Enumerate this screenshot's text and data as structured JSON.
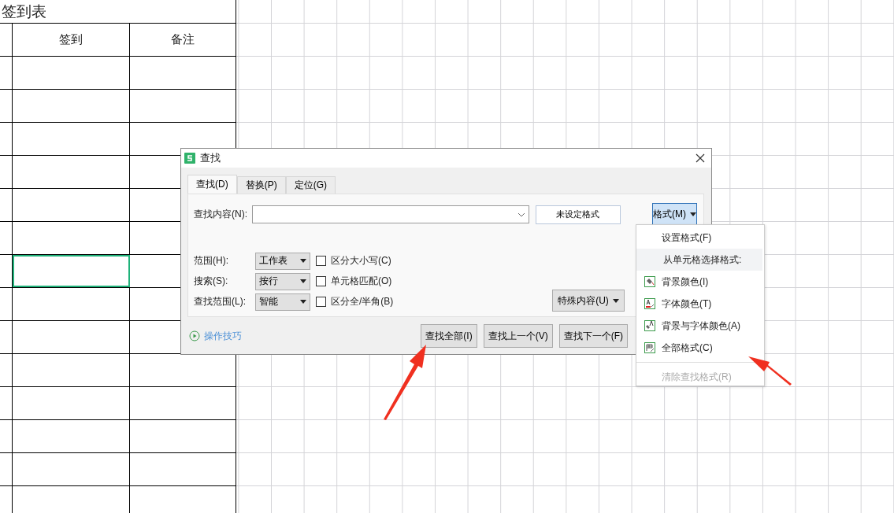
{
  "sheet": {
    "title": "签到表",
    "columns": [
      "签到",
      "备注"
    ],
    "rows": [
      {
        "selected": false
      },
      {
        "selected": false
      },
      {
        "selected": false
      },
      {
        "selected": false
      },
      {
        "selected": false
      },
      {
        "selected": false
      },
      {
        "selected": true
      },
      {
        "selected": false
      },
      {
        "selected": false
      },
      {
        "selected": false
      },
      {
        "selected": false
      },
      {
        "selected": false
      },
      {
        "selected": false
      },
      {
        "selected": false
      }
    ]
  },
  "dialog": {
    "title": "查找",
    "tabs": [
      {
        "label": "查找(D)",
        "selected": true
      },
      {
        "label": "替换(P)",
        "selected": false
      },
      {
        "label": "定位(G)",
        "selected": false
      }
    ],
    "find_label": "查找内容(N):",
    "format_status": "未设定格式",
    "format_button": {
      "label": "格式(M)",
      "pressed": true
    },
    "options": [
      {
        "label": "范围(H):",
        "value": "工作表",
        "checkbox": "区分大小写(C)",
        "checked": false
      },
      {
        "label": "搜索(S):",
        "value": "按行",
        "checkbox": "单元格匹配(O)",
        "checked": false
      },
      {
        "label": "查找范围(L):",
        "value": "智能",
        "checkbox": "区分全/半角(B)",
        "checked": false
      }
    ],
    "special_button": "特殊内容(U)",
    "tips_link": "操作技巧",
    "buttons": [
      "查找全部(I)",
      "查找上一个(V)",
      "查找下一个(F)"
    ]
  },
  "format_menu": [
    {
      "kind": "item",
      "label": "设置格式(F)",
      "disabled": false
    },
    {
      "kind": "header",
      "label": "从单元格选择格式:",
      "disabled": false
    },
    {
      "kind": "background",
      "label": "背景颜色(I)",
      "disabled": false
    },
    {
      "kind": "font",
      "label": "字体颜色(T)",
      "disabled": false
    },
    {
      "kind": "both",
      "label": "背景与字体颜色(A)",
      "disabled": false
    },
    {
      "kind": "all",
      "label": "全部格式(C)",
      "disabled": false
    },
    {
      "kind": "separator"
    },
    {
      "kind": "item",
      "label": "清除查找格式(R)",
      "disabled": true
    }
  ]
}
